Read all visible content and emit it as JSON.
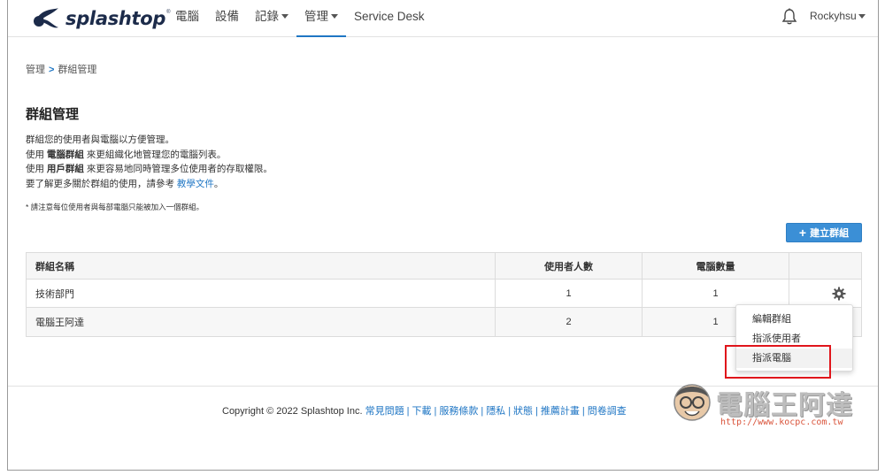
{
  "nav": {
    "logo_text": "splashtop",
    "logo_reg": "®",
    "items": [
      {
        "label": "電腦",
        "caret": false,
        "active": false
      },
      {
        "label": "設備",
        "caret": false,
        "active": false
      },
      {
        "label": "記錄",
        "caret": true,
        "active": false
      },
      {
        "label": "管理",
        "caret": true,
        "active": true
      },
      {
        "label": "Service Desk",
        "caret": false,
        "active": false
      }
    ],
    "user": "Rockyhsu"
  },
  "breadcrumb": {
    "parent": "管理",
    "separator": ">",
    "current": "群組管理"
  },
  "page": {
    "title": "群組管理",
    "desc1": "群組您的使用者與電腦以方便管理。",
    "desc2_pre": "使用 ",
    "desc2_bold": "電腦群組",
    "desc2_post": " 來更組織化地管理您的電腦列表。",
    "desc3_pre": "使用 ",
    "desc3_bold": "用戶群組",
    "desc3_post": " 來更容易地同時管理多位使用者的存取權限。",
    "desc4_pre": "要了解更多關於群組的使用，請參考 ",
    "desc4_link": "教學文件",
    "desc4_post": "。",
    "note": "* 請注意每位使用者與每部電腦只能被加入一個群組。",
    "create_button": "建立群組",
    "create_plus": "+"
  },
  "table": {
    "headers": [
      "群組名稱",
      "使用者人數",
      "電腦數量",
      ""
    ],
    "rows": [
      {
        "name": "技術部門",
        "users": "1",
        "computers": "1"
      },
      {
        "name": "電腦王阿達",
        "users": "2",
        "computers": "1"
      }
    ]
  },
  "dropdown": {
    "items": [
      "編輯群組",
      "指派使用者",
      "指派電腦"
    ]
  },
  "footer": {
    "copyright": "Copyright © 2022 Splashtop Inc.",
    "links": [
      "常見問題",
      "下載",
      "服務條款",
      "隱私",
      "狀態",
      "推薦計畫",
      "問卷調查"
    ],
    "separator": "|"
  },
  "watermark": {
    "title": "電腦王阿達",
    "url": "http://www.kocpc.com.tw"
  },
  "colors": {
    "accent": "#1f76c4",
    "button": "#3b8fd6",
    "highlight_box": "#e0151b"
  }
}
